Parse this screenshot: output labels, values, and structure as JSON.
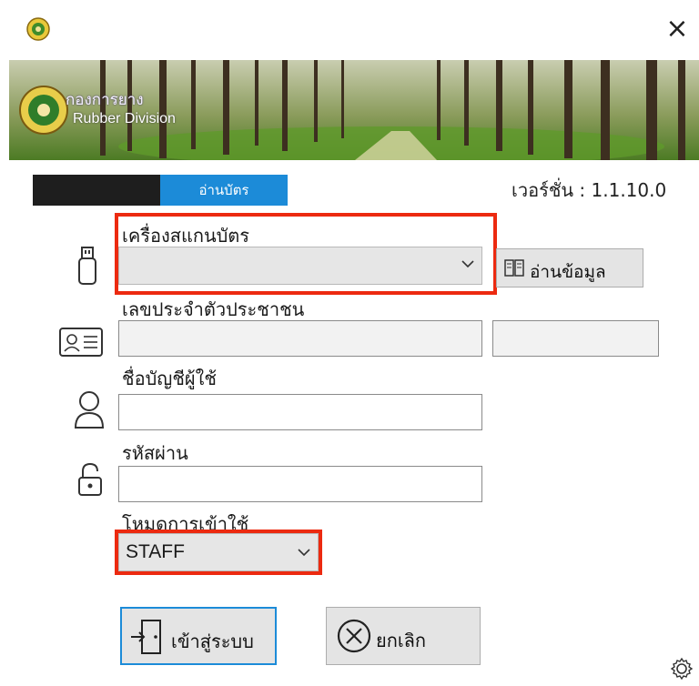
{
  "window": {
    "close_glyph": "×"
  },
  "banner": {
    "line1": "กองการยาง",
    "line2": "Rubber Division"
  },
  "tabs": {
    "active": "อ่านบัตร"
  },
  "version": "เวอร์ชั่น : 1.1.10.0",
  "scanner": {
    "label": "เครื่องสแกนบัตร",
    "value": "",
    "read_button": "อ่านข้อมูล"
  },
  "id_card": {
    "label": "เลขประจำตัวประชาชน",
    "value": "",
    "extra_value": ""
  },
  "username": {
    "label": "ชื่อบัญชีผู้ใช้",
    "value": ""
  },
  "password": {
    "label": "รหัสผ่าน",
    "value": ""
  },
  "mode": {
    "label": "โหมดการเข้าใช้",
    "value": "STAFF"
  },
  "actions": {
    "login": "เข้าสู่ระบบ",
    "cancel": "ยกเลิก"
  },
  "colors": {
    "highlight": "#ec2a10",
    "tab_active": "#1c8bd8",
    "tab_bar": "#1e1e1e"
  },
  "icons": [
    "app-emblem-icon",
    "close-icon",
    "usb-drive-icon",
    "book-icon",
    "id-card-icon",
    "user-icon",
    "lock-icon",
    "door-exit-icon",
    "cancel-circle-icon",
    "gear-icon"
  ]
}
